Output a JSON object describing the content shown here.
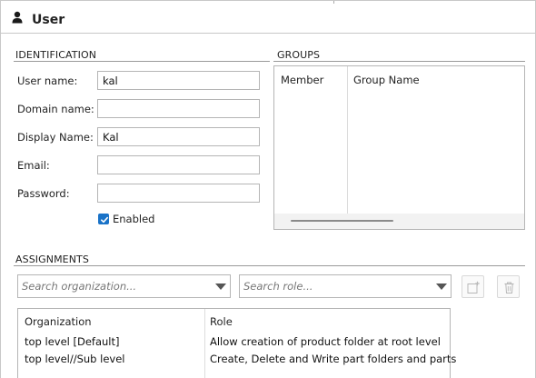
{
  "header": {
    "title": "User"
  },
  "identification": {
    "section_title": "IDENTIFICATION",
    "fields": {
      "user_name": {
        "label": "User name:",
        "value": "kal"
      },
      "domain_name": {
        "label": "Domain name:",
        "value": ""
      },
      "display_name": {
        "label": "Display Name:",
        "value": "Kal"
      },
      "email": {
        "label": "Email:",
        "value": ""
      },
      "password": {
        "label": "Password:",
        "value": ""
      }
    },
    "enabled": {
      "label": "Enabled",
      "checked": true
    }
  },
  "groups": {
    "section_title": "GROUPS",
    "columns": [
      "Member",
      "Group Name"
    ],
    "rows": []
  },
  "assignments": {
    "section_title": "ASSIGNMENTS",
    "search_organization": {
      "placeholder": "Search organization..."
    },
    "search_role": {
      "placeholder": "Search role..."
    },
    "add_button_icon": "add-assignment-icon",
    "delete_button_icon": "trash-icon",
    "columns": [
      "Organization",
      "Role"
    ],
    "rows": [
      {
        "organization": "top level [Default]",
        "role": "Allow creation of product folder at root level"
      },
      {
        "organization": "top level//Sub level",
        "role": "Create, Delete and Write part folders and parts"
      }
    ]
  },
  "colors": {
    "accent": "#1a73c8",
    "border": "#b5b5b5",
    "section_line": "#9a9a9a"
  }
}
